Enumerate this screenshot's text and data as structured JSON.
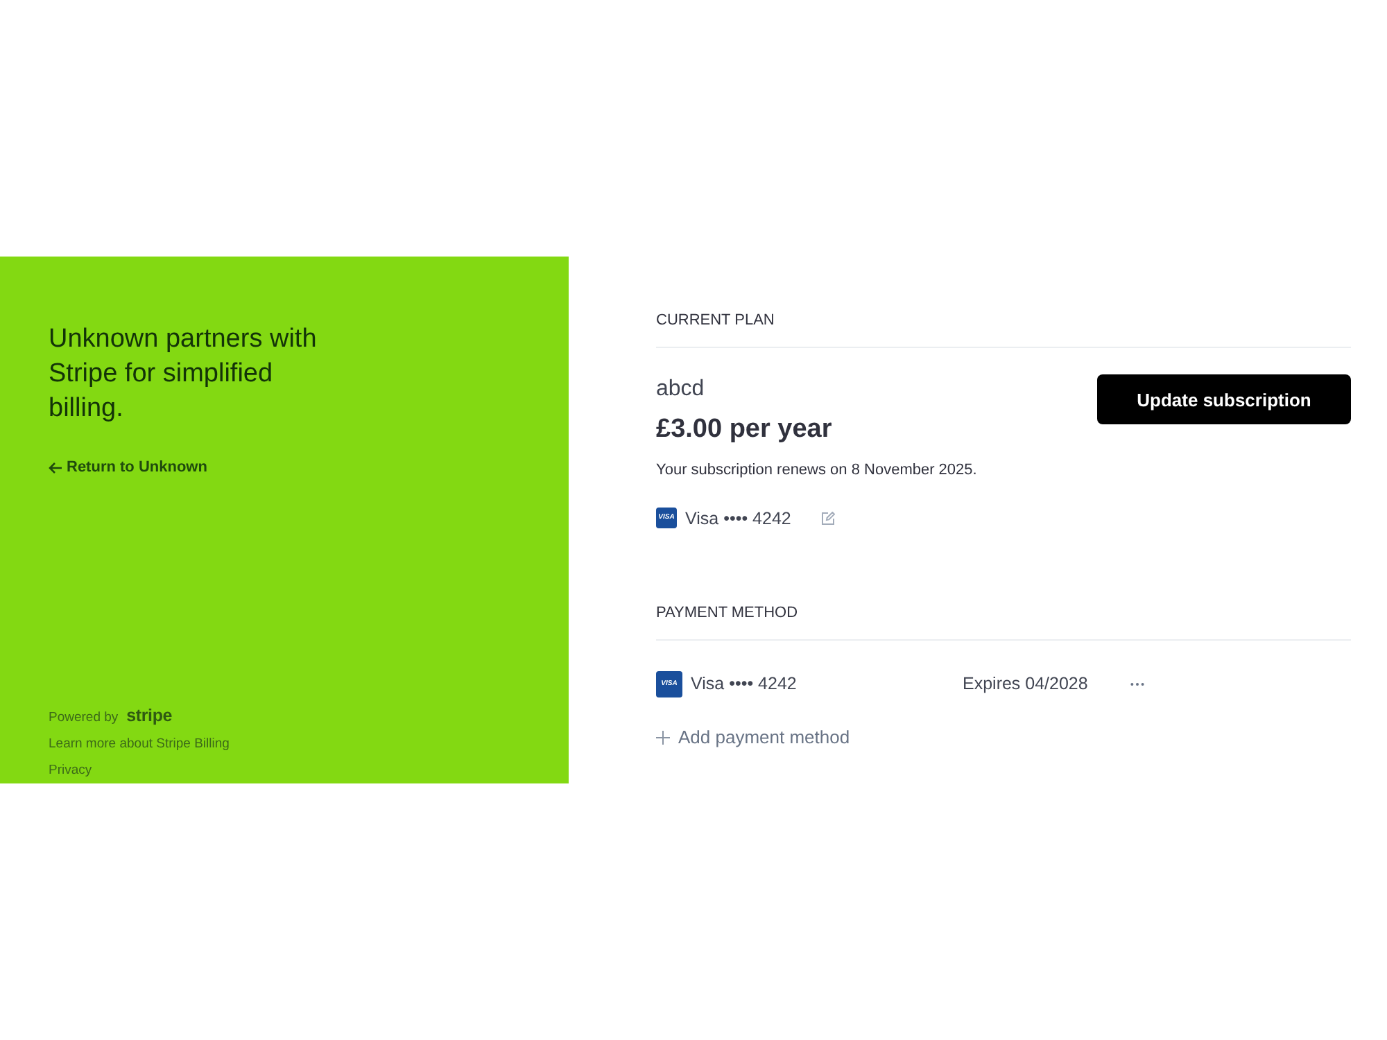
{
  "sidebar": {
    "headline": "Unknown partners with Stripe for simplified billing.",
    "return_link": "Return to Unknown",
    "powered_by": "Powered by",
    "brand": "stripe",
    "links": [
      "Learn more about Stripe Billing",
      "Privacy"
    ]
  },
  "current_plan": {
    "heading": "CURRENT PLAN",
    "plan_name": "abcd",
    "price": "£3.00 per year",
    "renewal_note": "Your subscription renews on 8 November 2025.",
    "card": {
      "brand_logo": "VISA",
      "label": "Visa •••• 4242"
    },
    "button": "Update subscription"
  },
  "payment_method": {
    "heading": "PAYMENT METHOD",
    "methods": [
      {
        "brand_logo": "VISA",
        "label": "Visa •••• 4242",
        "expiry": "Expires 04/2028"
      }
    ],
    "add_button": "Add payment method"
  }
}
